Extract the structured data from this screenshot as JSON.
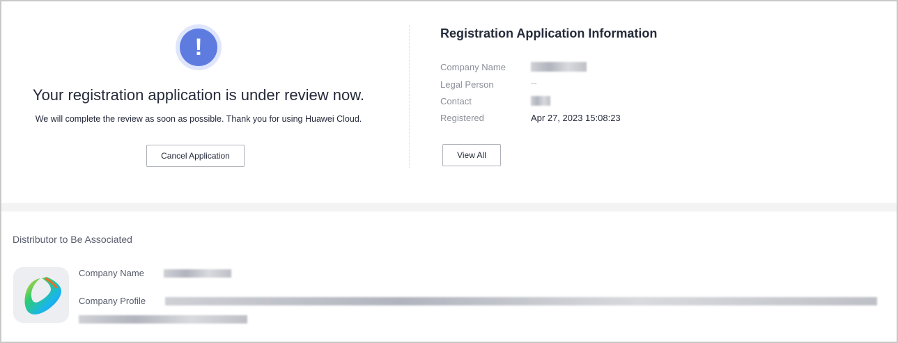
{
  "status": {
    "title": "Your registration application is under review now.",
    "subtitle": "We will complete the review as soon as possible. Thank you for using Huawei Cloud.",
    "cancel_label": "Cancel Application",
    "icon": "exclamation-icon"
  },
  "info": {
    "title": "Registration Application Information",
    "fields": [
      {
        "label": "Company Name",
        "value": ""
      },
      {
        "label": "Legal Person",
        "value": "--"
      },
      {
        "label": "Contact",
        "value": ""
      },
      {
        "label": "Registered",
        "value": "Apr 27, 2023 15:08:23"
      }
    ],
    "view_all_label": "View All"
  },
  "distributor": {
    "heading": "Distributor to Be Associated",
    "name_label": "Company Name",
    "profile_label": "Company Profile"
  },
  "colors": {
    "accent": "#5e7ce0"
  }
}
